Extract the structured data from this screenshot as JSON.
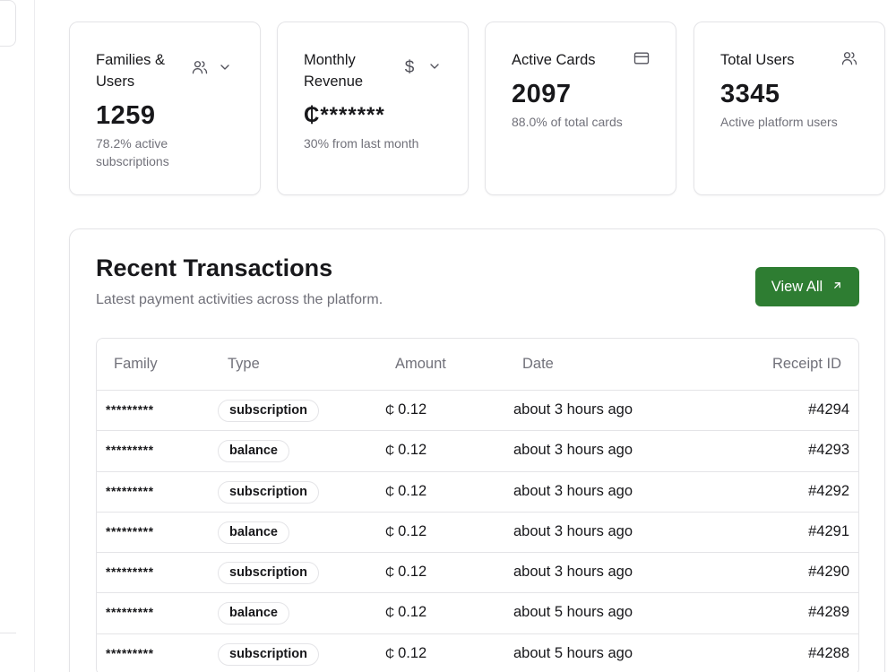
{
  "stats": [
    {
      "title": "Families & Users",
      "value": "1259",
      "subtitle": "78.2% active subscriptions",
      "icon": "users-icon",
      "dropdown": true
    },
    {
      "title": "Monthly Revenue",
      "value": "₵*******",
      "subtitle": "30% from last month",
      "icon": "dollar-icon",
      "dropdown": true
    },
    {
      "title": "Active Cards",
      "value": "2097",
      "subtitle": "88.0% of total cards",
      "icon": "credit-card-icon",
      "dropdown": false
    },
    {
      "title": "Total Users",
      "value": "3345",
      "subtitle": "Active platform users",
      "icon": "users-icon",
      "dropdown": false
    }
  ],
  "transactions": {
    "title": "Recent Transactions",
    "description": "Latest payment activities across the platform.",
    "view_all_label": "View All",
    "columns": {
      "family": "Family",
      "type": "Type",
      "amount": "Amount",
      "date": "Date",
      "receipt": "Receipt ID"
    },
    "currency_symbol": "₵",
    "rows": [
      {
        "family": "*********",
        "type": "subscription",
        "amount": "0.12",
        "date": "about 3 hours ago",
        "receipt": "#4294"
      },
      {
        "family": "*********",
        "type": "balance",
        "amount": "0.12",
        "date": "about 3 hours ago",
        "receipt": "#4293"
      },
      {
        "family": "*********",
        "type": "subscription",
        "amount": "0.12",
        "date": "about 3 hours ago",
        "receipt": "#4292"
      },
      {
        "family": "*********",
        "type": "balance",
        "amount": "0.12",
        "date": "about 3 hours ago",
        "receipt": "#4291"
      },
      {
        "family": "*********",
        "type": "subscription",
        "amount": "0.12",
        "date": "about 3 hours ago",
        "receipt": "#4290"
      },
      {
        "family": "*********",
        "type": "balance",
        "amount": "0.12",
        "date": "about 5 hours ago",
        "receipt": "#4289"
      },
      {
        "family": "*********",
        "type": "subscription",
        "amount": "0.12",
        "date": "about 5 hours ago",
        "receipt": "#4288"
      }
    ]
  },
  "colors": {
    "accent": "#2e7d32",
    "muted_text": "#71717a",
    "border": "#e4e4e7"
  }
}
